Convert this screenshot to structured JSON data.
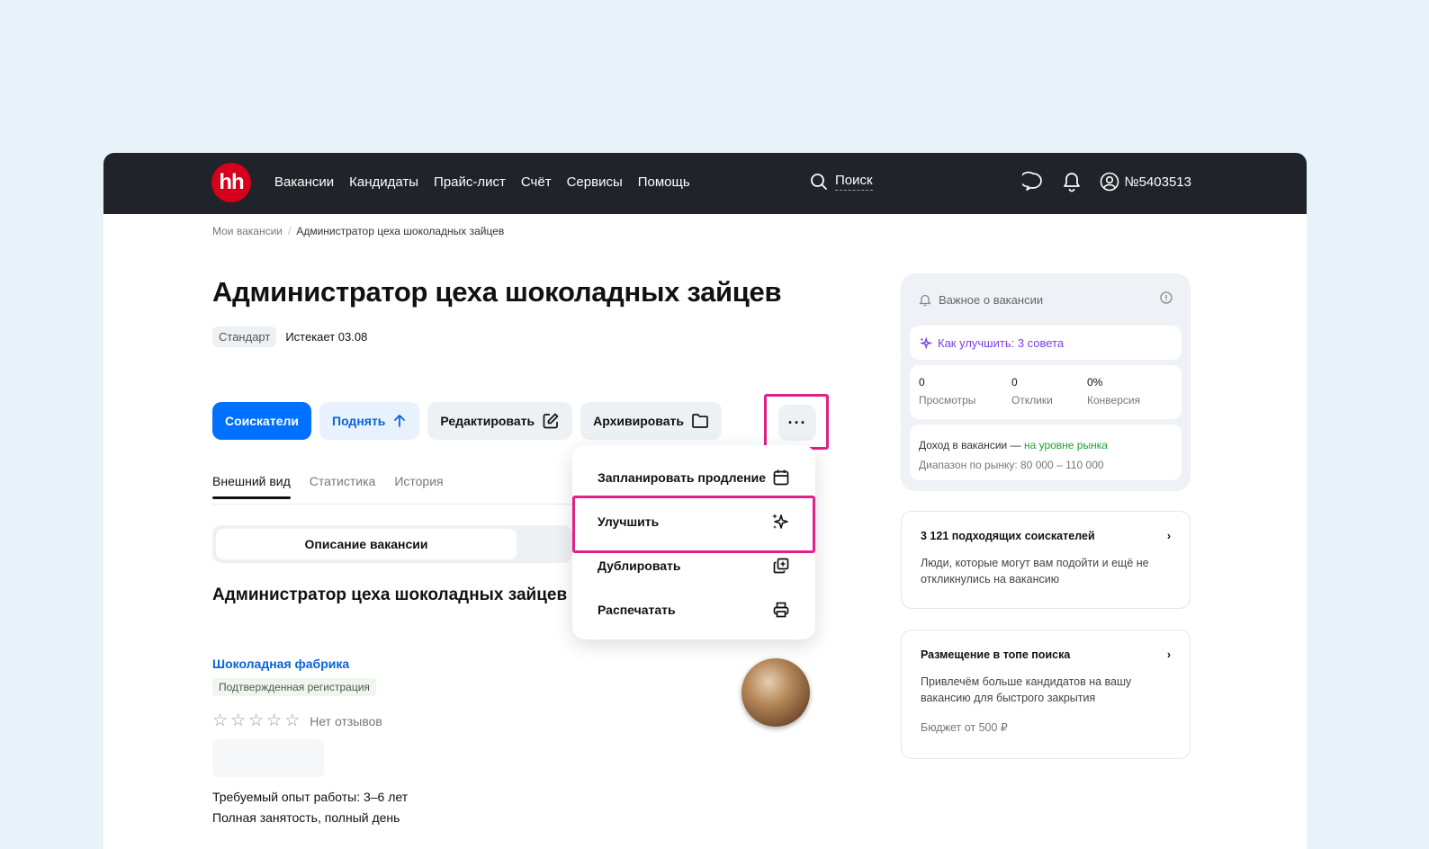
{
  "topbar": {
    "logo": "hh",
    "nav": [
      "Вакансии",
      "Кандидаты",
      "Прайс-лист",
      "Счёт",
      "Сервисы",
      "Помощь"
    ],
    "search_label": "Поиск",
    "user_id": "№5403513"
  },
  "breadcrumb": {
    "parent": "Мои вакансии",
    "current": "Администратор цеха шоколадных зайцев"
  },
  "vacancy": {
    "title": "Администратор цеха шоколадных зайцев",
    "tariff": "Стандарт",
    "expires": "Истекает 03.08"
  },
  "actions": {
    "candidates": "Соискатели",
    "raise": "Поднять",
    "edit": "Редактировать",
    "archive": "Архивировать",
    "more": "···"
  },
  "tabs": [
    "Внешний вид",
    "Статистика",
    "История"
  ],
  "segment": {
    "description": "Описание вакансии"
  },
  "content": {
    "title": "Администратор цеха шоколадных зайцев",
    "company": "Шоколадная фабрика",
    "verified": "Подтвержденная регистрация",
    "stars_count": 5,
    "no_reviews": "Нет отзывов",
    "experience": "Требуемый опыт работы: 3–6 лет",
    "employment": "Полная занятость, полный день"
  },
  "menu": {
    "schedule": "Запланировать продление",
    "improve": "Улучшить",
    "duplicate": "Дублировать",
    "print": "Распечатать"
  },
  "panel": {
    "heading": "Важное о вакансии",
    "tip": "Как улучшить: 3 совета",
    "views_value": "0",
    "views_label": "Просмотры",
    "responses_value": "0",
    "responses_label": "Отклики",
    "conversion_value": "0%",
    "conversion_label": "Конверсия",
    "income_text": "Доход в вакансии — ",
    "income_status": "на уровне рынка",
    "range_text": "Диапазон по рынку: 80 000 – 110 000"
  },
  "cards": {
    "matching_title": "3 121 подходящих соискателей",
    "matching_desc": "Люди, которые могут вам подойти и ещё не откликнулись на вакансию",
    "top_title": "Размещение в топе поиска",
    "top_desc": "Привлечём больше кандидатов на вашу вакансию для быстрого закрытия",
    "top_budget": "Бюджет от 500 ₽"
  },
  "colors": {
    "brand": "#d6001c",
    "primary": "#0070ff",
    "highlight": "#e0218a",
    "market_green": "#1ca336",
    "tip_purple": "#7a3fe4"
  },
  "icons": [
    "search-icon",
    "chat-icon",
    "bell-icon",
    "user-icon",
    "arrow-up-icon",
    "edit-icon",
    "folder-icon",
    "calendar-icon",
    "sparkle-icon",
    "duplicate-icon",
    "printer-icon",
    "info-icon",
    "chevron-right-icon",
    "star-icon"
  ]
}
